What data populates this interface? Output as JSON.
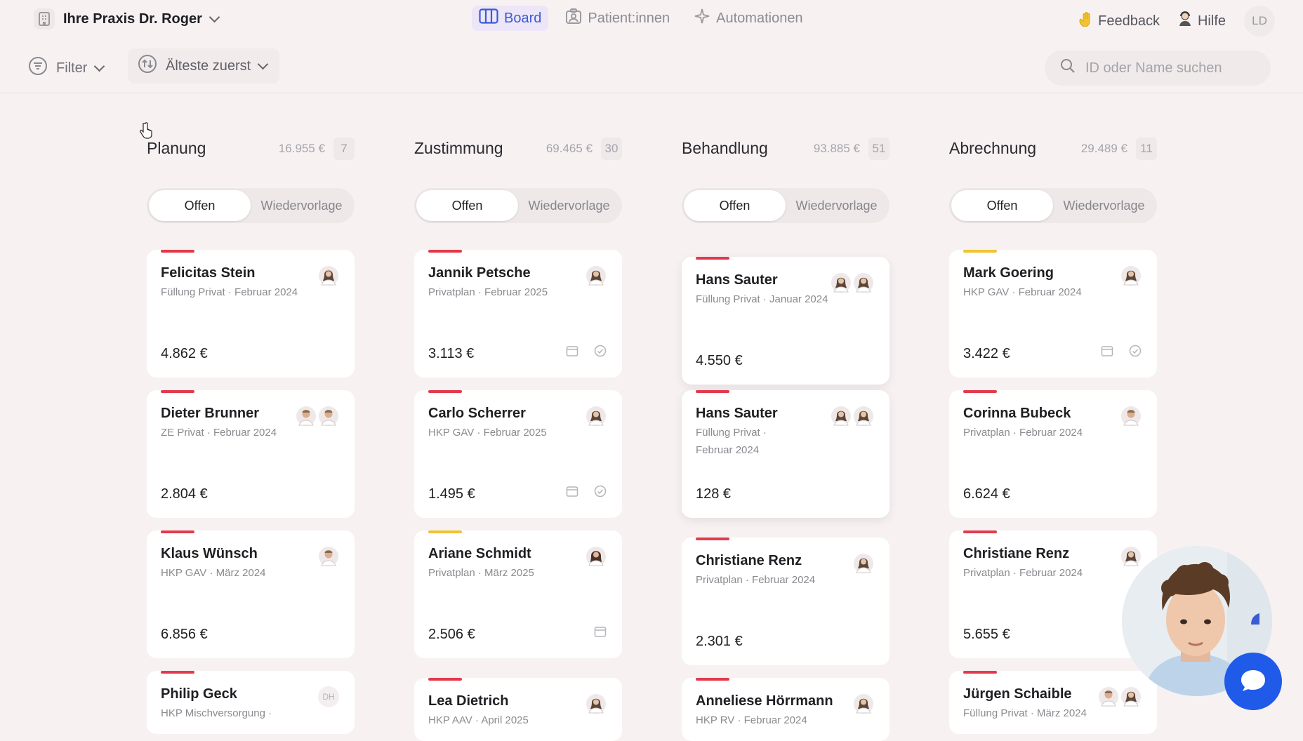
{
  "header": {
    "practice_name": "Ihre Praxis Dr. Roger",
    "nav": [
      {
        "label": "Board",
        "icon": "board-icon",
        "active": true
      },
      {
        "label": "Patient:innen",
        "icon": "patients-icon",
        "active": false
      },
      {
        "label": "Automationen",
        "icon": "sparkle-icon",
        "active": false
      }
    ],
    "feedback_label": "Feedback",
    "help_label": "Hilfe",
    "user_initials": "LD"
  },
  "toolbar": {
    "filter_label": "Filter",
    "sort_label": "Älteste zuerst",
    "search_placeholder": "ID oder Name suchen"
  },
  "colors": {
    "accent": "#3b5bd6",
    "urgent_bar": "#e23a4c",
    "warning_bar": "#f2c230",
    "background": "#f7f1f2"
  },
  "columns": [
    {
      "title": "Planung",
      "amount": "16.955 €",
      "count": "7",
      "tabs": [
        "Offen",
        "Wiedervorlage"
      ],
      "cards": [
        {
          "name": "Felicitas Stein",
          "sub": "Füllung Privat · Februar 2024",
          "amount": "4.862 €",
          "bar": "red"
        },
        {
          "name": "Dieter Brunner",
          "sub": "ZE Privat · Februar 2024",
          "amount": "2.804 €",
          "bar": "red"
        },
        {
          "name": "Klaus Wünsch",
          "sub": "HKP GAV · März 2024",
          "amount": "6.856 €",
          "bar": "red"
        },
        {
          "name": "Philip Geck",
          "sub": "HKP Mischversorgung ·",
          "initials": "DH",
          "bar": "red"
        }
      ]
    },
    {
      "title": "Zustimmung",
      "amount": "69.465 €",
      "count": "30",
      "tabs": [
        "Offen",
        "Wiedervorlage"
      ],
      "cards": [
        {
          "name": "Jannik Petsche",
          "sub": "Privatplan · Februar 2025",
          "amount": "3.113 €",
          "bar": "red"
        },
        {
          "name": "Carlo Scherrer",
          "sub": "HKP GAV · Februar 2025",
          "amount": "1.495 €",
          "bar": "red"
        },
        {
          "name": "Ariane Schmidt",
          "sub": "Privatplan · März 2025",
          "amount": "2.506 €",
          "bar": "yellow"
        },
        {
          "name": "Lea Dietrich",
          "sub": "HKP AAV · April 2025",
          "bar": "red"
        }
      ]
    },
    {
      "title": "Behandlung",
      "amount": "93.885 €",
      "count": "51",
      "tabs": [
        "Offen",
        "Wiedervorlage"
      ],
      "cards": [
        {
          "name": "Hans Sauter",
          "sub": "Füllung Privat · Januar 2024",
          "amount": "4.550 €",
          "bar": "red"
        },
        {
          "name": "Hans Sauter",
          "sub": "Füllung Privat ·",
          "sub2": "Februar 2024",
          "amount": "128 €",
          "bar": "red"
        },
        {
          "name": "Christiane Renz",
          "sub": "Privatplan · Februar 2024",
          "amount": "2.301 €",
          "bar": "red"
        },
        {
          "name": "Anneliese Hörrmann",
          "sub": "HKP RV · Februar 2024",
          "bar": "red"
        }
      ]
    },
    {
      "title": "Abrechnung",
      "amount": "29.489 €",
      "count": "11",
      "tabs": [
        "Offen",
        "Wiedervorlage"
      ],
      "cards": [
        {
          "name": "Mark Goering",
          "sub": "HKP GAV · Februar 2024",
          "amount": "3.422 €",
          "bar": "yellow"
        },
        {
          "name": "Corinna Bubeck",
          "sub": "Privatplan · Februar 2024",
          "amount": "6.624 €",
          "bar": "red"
        },
        {
          "name": "Christiane Renz",
          "sub": "Privatplan · Februar 2024",
          "amount": "5.655 €",
          "bar": "red"
        },
        {
          "name": "Jürgen Schaible",
          "sub": "Füllung Privat · März 2024",
          "bar": "red"
        }
      ]
    }
  ]
}
